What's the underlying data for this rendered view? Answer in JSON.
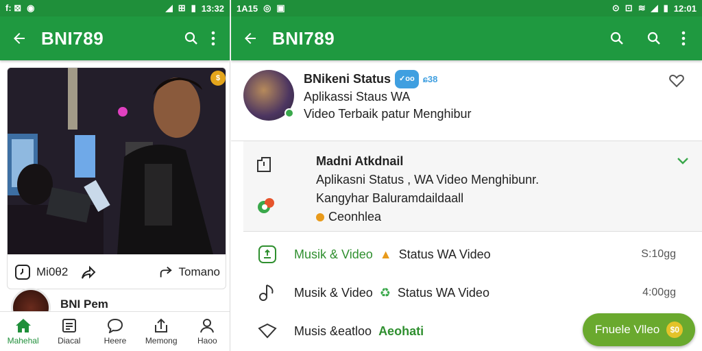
{
  "left": {
    "statusbar": {
      "left": "f:  ⊠",
      "right": "13:32"
    },
    "appbar": {
      "title": "BNI789"
    },
    "card": {
      "badge": "$",
      "action_left_label": "Mi0θ2",
      "action_right_label": "Tomano"
    },
    "next_item": {
      "title": "BNI Pem"
    },
    "bottom_nav": [
      {
        "label": "Mahehal",
        "icon": "home-icon"
      },
      {
        "label": "Diacal",
        "icon": "document-icon"
      },
      {
        "label": "Heere",
        "icon": "chat-icon"
      },
      {
        "label": "Memong",
        "icon": "upload-icon"
      },
      {
        "label": "Haoo",
        "icon": "person-icon"
      }
    ]
  },
  "right": {
    "statusbar": {
      "left": "1A15",
      "right": "12:01"
    },
    "appbar": {
      "title": "BNI789"
    },
    "profile": {
      "name": "BNikeni Status",
      "verified": "✓oo",
      "count": "ɕ38",
      "line1": "Aplikassi Staus WA",
      "line2": "Video Terbaik  patur Menghibur"
    },
    "section": {
      "heading": "Madni Atkdnail",
      "line1": "Aplikasni Status , WA Video Menghibunr.",
      "line2": "Kangyhar Baluramdaildaall",
      "live": "Ceonhlea"
    },
    "rows": [
      {
        "title": "Musik & Video",
        "extra": "Status WA Video",
        "size": "S:10gg",
        "title_green": true
      },
      {
        "title": "Musik & Video",
        "extra": "Status WA Video",
        "size": "4:00gg",
        "title_green": false
      },
      {
        "title": "Musis &eatloo",
        "extra": "Aeohati",
        "size": "",
        "title_green": false
      }
    ],
    "fab": {
      "label": "Fnuele Vlleo",
      "badge": "$0"
    }
  }
}
